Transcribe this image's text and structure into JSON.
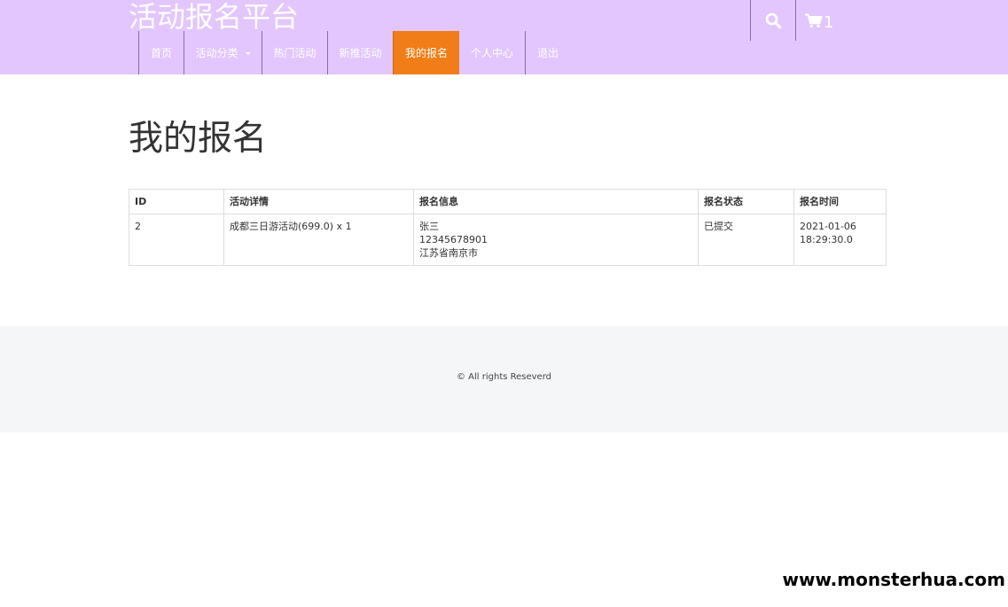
{
  "header": {
    "site_title": "活动报名平台",
    "cart_count": "1",
    "background": "#e3c6fd"
  },
  "nav": {
    "items": [
      {
        "label": "首页"
      },
      {
        "label": "活动分类"
      },
      {
        "label": "热门活动"
      },
      {
        "label": "新推活动"
      },
      {
        "label": "我的报名"
      },
      {
        "label": "个人中心"
      },
      {
        "label": "退出"
      }
    ],
    "active_color": "#f07d17"
  },
  "main": {
    "page_title": "我的报名",
    "table": {
      "headers": [
        "ID",
        "活动详情",
        "报名信息",
        "报名状态",
        "报名时间"
      ],
      "rows": [
        {
          "id": "2",
          "detail": "成都三日游活动(699.0) x 1",
          "info_name": "张三",
          "info_phone": "12345678901",
          "info_address": "江苏省南京市",
          "status": "已提交",
          "time_date": "2021-01-06",
          "time_clock": "18:29:30.0"
        }
      ]
    }
  },
  "footer": {
    "copyright": "© All rights Reseverd"
  },
  "watermark": {
    "text": "www.monsterhua.com"
  },
  "icons": [
    "search-icon",
    "cart-icon",
    "chevron-down-icon"
  ]
}
